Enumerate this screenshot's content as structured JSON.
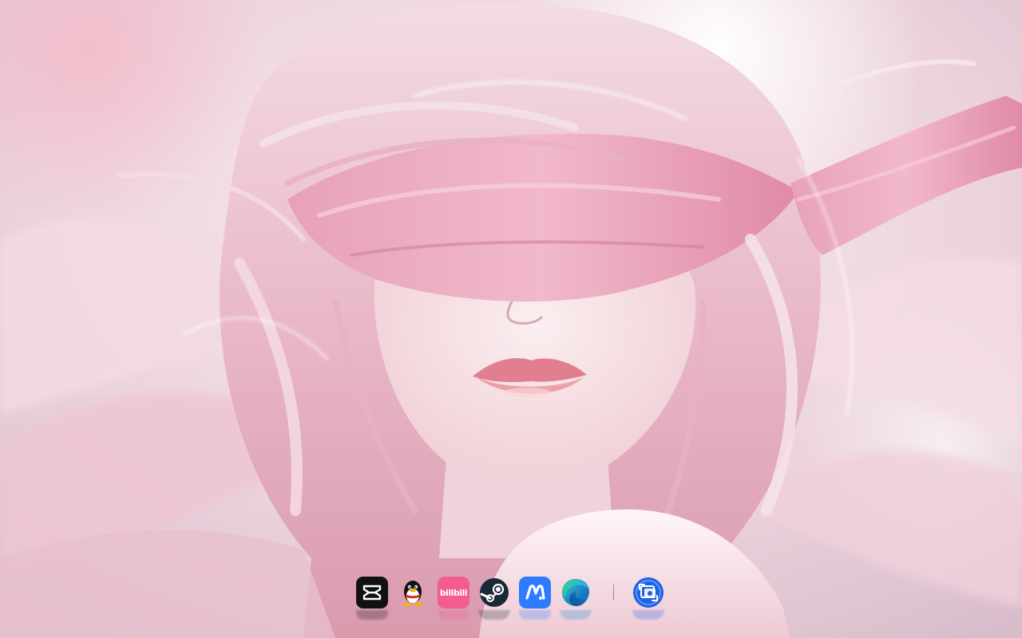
{
  "wallpaper": {
    "colors": {
      "background": "#e9d3dc",
      "hair_light": "#f6e6ec",
      "hair_pink": "#e8a9bf",
      "ribbon": "#e69ab4",
      "skin": "#f6dfe2",
      "lips": "#e27f8e"
    }
  },
  "dock": {
    "items": [
      {
        "name": "capcut",
        "icon": "capcut-icon",
        "color": "#111111"
      },
      {
        "name": "qq",
        "icon": "qq-penguin-icon",
        "color": "#ffffff"
      },
      {
        "name": "bilibili",
        "icon": "bilibili-icon",
        "label": "bilibili",
        "color": "#f25d8e"
      },
      {
        "name": "steam",
        "icon": "steam-icon",
        "color": "#1b2838"
      },
      {
        "name": "app-m",
        "icon": "m-app-icon",
        "color": "#2f7bff"
      },
      {
        "name": "edge",
        "icon": "edge-icon",
        "color": "#0c8ce0"
      },
      {
        "name": "screenshot",
        "icon": "screenshot-icon",
        "color": "#1e62e6"
      }
    ]
  }
}
